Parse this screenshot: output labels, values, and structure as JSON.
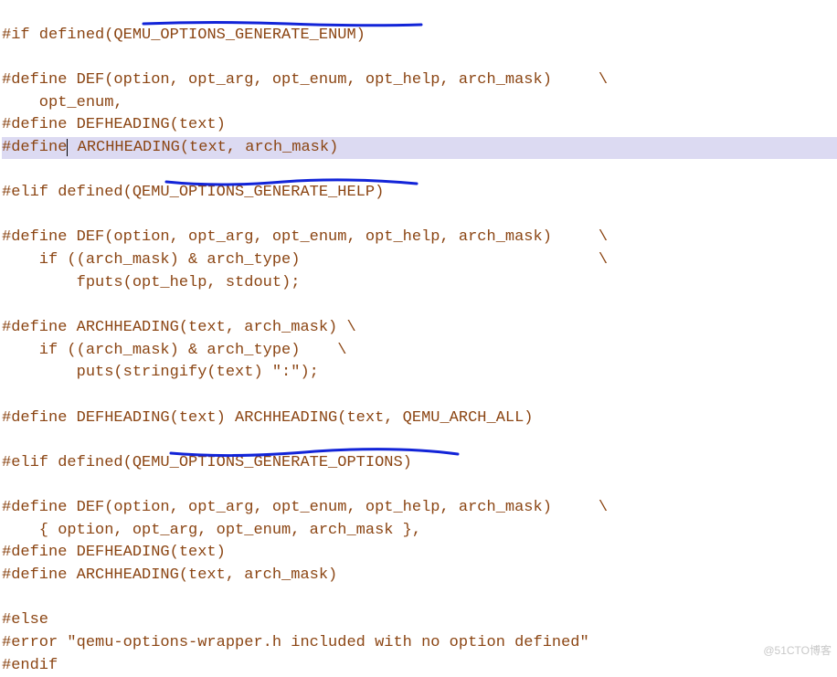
{
  "lines": {
    "l1a": "#if",
    "l1b": " defined(QEMU_OPTIONS_GENERATE_ENUM)",
    "l2": "",
    "l3": "#define DEF(option, opt_arg, opt_enum, opt_help, arch_mask)     \\",
    "l4": "    opt_enum,",
    "l5": "#define DEFHEADING(text)",
    "l6a": "#define",
    "l6b": " ARCHHEADING(text, arch_mask)",
    "l7": "",
    "l8": "#elif defined(QEMU_OPTIONS_GENERATE_HELP)",
    "l9": "",
    "l10": "#define DEF(option, opt_arg, opt_enum, opt_help, arch_mask)     \\",
    "l11": "    if ((arch_mask) & arch_type)                                \\",
    "l12": "        fputs(opt_help, stdout);",
    "l13": "",
    "l14": "#define ARCHHEADING(text, arch_mask) \\",
    "l15": "    if ((arch_mask) & arch_type)    \\",
    "l16": "        puts(stringify(text) \":\");",
    "l17": "",
    "l18": "#define DEFHEADING(text) ARCHHEADING(text, QEMU_ARCH_ALL)",
    "l19": "",
    "l20": "#elif defined(QEMU_OPTIONS_GENERATE_OPTIONS)",
    "l21": "",
    "l22": "#define DEF(option, opt_arg, opt_enum, opt_help, arch_mask)     \\",
    "l23": "    { option, opt_arg, opt_enum, arch_mask },",
    "l24": "#define DEFHEADING(text)",
    "l25": "#define ARCHHEADING(text, arch_mask)",
    "l26": "",
    "l27": "#else",
    "l28": "#error \"qemu-options-wrapper.h included with no option defined\"",
    "l29": "#endif"
  },
  "watermark": "@51CTO博客"
}
